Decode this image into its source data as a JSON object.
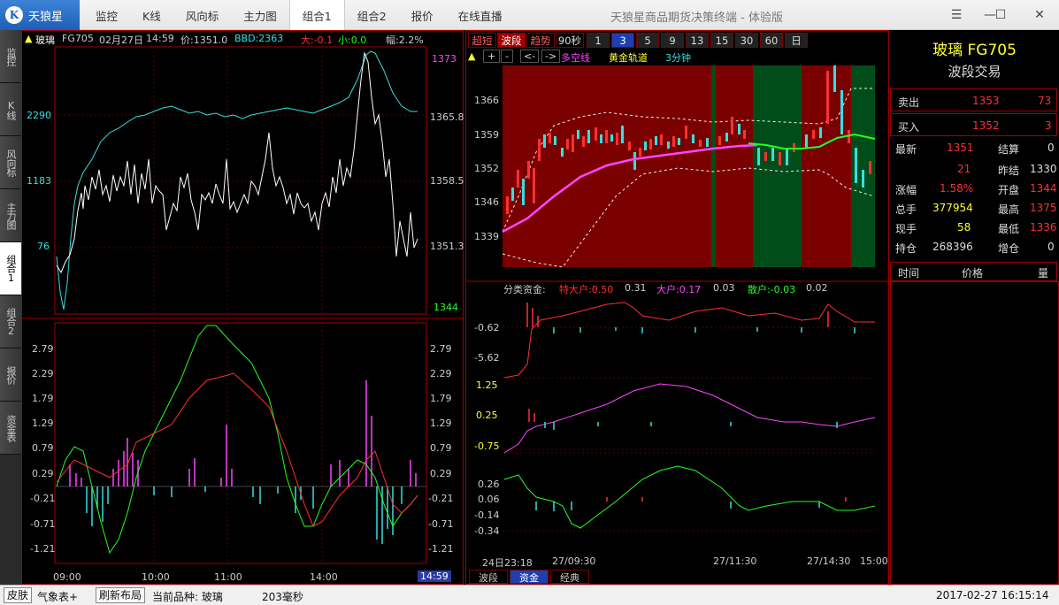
{
  "app": {
    "logo_text": "天狼星",
    "window_title": "天狼星商品期货决策终端 - 体验版",
    "menu": [
      "监控",
      "K线",
      "风向标",
      "主力图",
      "组合1",
      "组合2",
      "报价",
      "在线直播"
    ],
    "active_menu": 4
  },
  "left_tabs": [
    "监控",
    "K线",
    "风向标",
    "主力图",
    "组合1",
    "组合2",
    "报价",
    "资金表"
  ],
  "active_left_tab": 4,
  "left_panel": {
    "header": {
      "name": "玻璃",
      "code": "FG705",
      "date": "02月27日",
      "time": "14:59",
      "price": "价:1351.0",
      "bbd": "BBD:2363",
      "big": "大:-0.1",
      "small": "小:0.0",
      "range": "幅:2.2%"
    },
    "price_axis_right": [
      "1373",
      "1365.8",
      "1358.5",
      "1351.3",
      "1344"
    ],
    "volume_axis_left": [
      "2290",
      "1183",
      "76"
    ],
    "osc_axis": [
      "2.79",
      "2.29",
      "1.79",
      "1.29",
      "0.79",
      "0.29",
      "-0.21",
      "-0.71",
      "-1.21"
    ],
    "time_axis": [
      "09:00",
      "10:00",
      "11:00",
      "14:00"
    ],
    "current_time": "14:59"
  },
  "kline_panel": {
    "buttons": [
      "超短",
      "波段",
      "趋势",
      "90秒",
      "1",
      "3",
      "5",
      "9",
      "13",
      "15",
      "30",
      "60",
      "日"
    ],
    "active_mode": 1,
    "active_period": 5,
    "toolbar": [
      "▲",
      "+",
      "-",
      "<-",
      "->"
    ],
    "indicators": {
      "a": "多空线",
      "b": "黄金轨道",
      "c": "3分钟"
    },
    "price_axis": [
      "1366",
      "1359",
      "1352",
      "1346",
      "1339"
    ]
  },
  "fund_panel": {
    "header": {
      "title": "分类资金:",
      "special_label": "特大户:0.50",
      "special_val": "0.31",
      "big_label": "大户:0.17",
      "big_val": "0.03",
      "retail_label": "散户:-0.03",
      "retail_val": "0.02"
    },
    "axis1": [
      "-0.62",
      "-5.62"
    ],
    "axis2": [
      "1.25",
      "0.25",
      "-0.75"
    ],
    "axis3": [
      "0.26",
      "0.06",
      "-0.14",
      "-0.34"
    ],
    "time_axis": [
      "24日23:18",
      "27/09:30",
      "27/11:30",
      "27/14:30",
      "15:00"
    ],
    "bottom_tabs": [
      "波段",
      "资金",
      "经典"
    ],
    "active_bottom_tab": 1
  },
  "info": {
    "title": "玻璃 FG705",
    "subtitle": "波段交易",
    "sell": {
      "label": "卖出",
      "price": "1353",
      "qty": "73"
    },
    "buy": {
      "label": "买入",
      "price": "1352",
      "qty": "3"
    },
    "rows": [
      {
        "l1": "最新",
        "v1": "1351",
        "l2": "结算",
        "v2": "0"
      },
      {
        "l1": "",
        "v1": "21",
        "l2": "昨结",
        "v2": "1330"
      },
      {
        "l1": "涨幅",
        "v1": "1.58%",
        "l2": "开盘",
        "v2": "1344"
      },
      {
        "l1": "总手",
        "v1": "377954",
        "l2": "最高",
        "v2": "1375"
      },
      {
        "l1": "现手",
        "v1": "58",
        "l2": "最低",
        "v2": "1336"
      },
      {
        "l1": "持仓",
        "v1": "268396",
        "l2": "增仓",
        "v2": "0"
      }
    ],
    "columns": [
      "时间",
      "价格",
      "量"
    ]
  },
  "status": {
    "skin": "皮肤",
    "weather": "气象表+",
    "refresh": "刷新布局",
    "current": "当前品种: 玻璃",
    "latency": "203毫秒",
    "datetime": "2017-02-27 16:15:14"
  },
  "colors": {
    "red": "#ff3030",
    "cyan": "#33e0e0",
    "green": "#22ff22",
    "magenta": "#ff44ff",
    "yellow": "#ffff33",
    "dark_red_bg": "#7a0000",
    "dark_green_bg": "#004d1a"
  }
}
